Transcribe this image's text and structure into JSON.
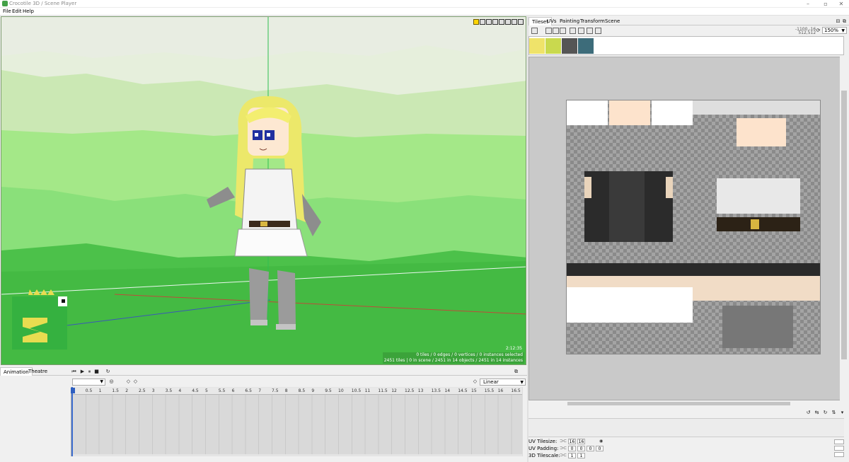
{
  "window": {
    "title": "Crocotile 3D / Scene Player",
    "minimize": "–",
    "maximize": "▫",
    "close": "✕"
  },
  "menu": [
    "File",
    "Edit",
    "Help"
  ],
  "viewport": {
    "clock": "2:12:35",
    "stats_line1": "0 tiles / 0 edges / 0 vertices / 0 instances selected",
    "stats_line2": "2451 tiles | 0 in scene / 2451 in 14 objects / 2451 in 14 instances"
  },
  "animation": {
    "tabs": [
      "Animation",
      "Theatre"
    ],
    "interpolation": "Linear",
    "ticks": [
      "0",
      "0.5",
      "1",
      "1.5",
      "2",
      "2.5",
      "3",
      "3.5",
      "4",
      "4.5",
      "5",
      "5.5",
      "6",
      "6.5",
      "7",
      "7.5",
      "8",
      "8.5",
      "9",
      "9.5",
      "10",
      "10.5",
      "11",
      "11.5",
      "12",
      "12.5",
      "13",
      "13.5",
      "14",
      "14.5",
      "15",
      "15.5",
      "16",
      "16.5"
    ]
  },
  "right_panel": {
    "tabs": [
      "Tileset",
      "UVs",
      "Painting",
      "Transform",
      "Scene"
    ],
    "coords_line1": "-1100,-16",
    "coords_line2": "512,512",
    "zoom": "150%"
  },
  "uv_props": {
    "tilesize_label": "UV Tilesize:",
    "tilesize_values": [
      "16",
      "16"
    ],
    "padding_label": "UV Padding:",
    "padding_values": [
      "0",
      "0",
      "0",
      "0"
    ],
    "tilescale_label": "3D Tilescale:",
    "tilescale_values": [
      "1",
      "1"
    ]
  },
  "colors": {
    "accent": "#ffd600",
    "grass": "#44c044",
    "sky": "#cde7bd",
    "cursor": "#3f6fd0"
  }
}
